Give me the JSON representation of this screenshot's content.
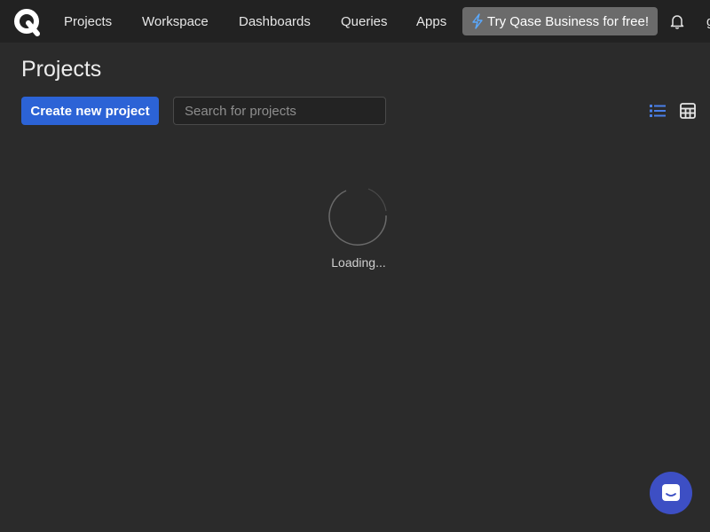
{
  "nav": {
    "items": [
      {
        "label": "Projects"
      },
      {
        "label": "Workspace"
      },
      {
        "label": "Dashboards"
      },
      {
        "label": "Queries"
      },
      {
        "label": "Apps"
      }
    ],
    "promo_label": "Try Qase Business for free!",
    "edge_glyph": "g"
  },
  "page": {
    "title": "Projects",
    "create_label": "Create new project",
    "search_placeholder": "Search for projects",
    "loading_text": "Loading..."
  },
  "colors": {
    "background": "#2b2b2b",
    "topbar": "#222222",
    "primary": "#2c63d6",
    "promo": "#6b6b6b",
    "active_view": "#4a7fe8",
    "chat": "#3d4fc4"
  },
  "icons": [
    "qase-logo",
    "lightning-icon",
    "bell-icon",
    "list-view-icon",
    "grid-view-icon",
    "loading-spinner",
    "chat-icon"
  ]
}
